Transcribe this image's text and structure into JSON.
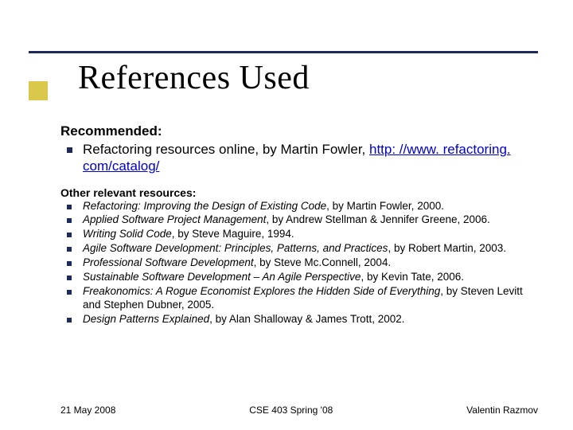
{
  "title": "References Used",
  "recommended": {
    "heading": "Recommended:",
    "item_text": "Refactoring resources online, by Martin Fowler, ",
    "item_link": "http: //www. refactoring. com/catalog/"
  },
  "other": {
    "heading": "Other relevant resources:",
    "items": [
      {
        "title": "Refactoring: Improving the Design of Existing Code",
        "rest": ", by Martin Fowler, 2000."
      },
      {
        "title": "Applied Software Project Management",
        "rest": ", by Andrew Stellman & Jennifer Greene, 2006."
      },
      {
        "title": "Writing Solid Code",
        "rest": ", by Steve Maguire, 1994."
      },
      {
        "title": "Agile Software Development: Principles, Patterns, and Practices",
        "rest": ", by Robert Martin, 2003."
      },
      {
        "title": "Professional Software Development",
        "rest": ", by Steve Mc.Connell, 2004."
      },
      {
        "title": "Sustainable Software Development – An Agile Perspective",
        "rest": ", by Kevin Tate, 2006."
      },
      {
        "title": "Freakonomics: A Rogue Economist Explores the Hidden Side of Everything",
        "rest": ", by Steven Levitt and Stephen Dubner, 2005."
      },
      {
        "title": "Design Patterns Explained",
        "rest": ", by Alan Shalloway & James Trott, 2002."
      }
    ]
  },
  "footer": {
    "date": "21 May 2008",
    "course": "CSE 403 Spring '08",
    "author": "Valentin Razmov"
  }
}
